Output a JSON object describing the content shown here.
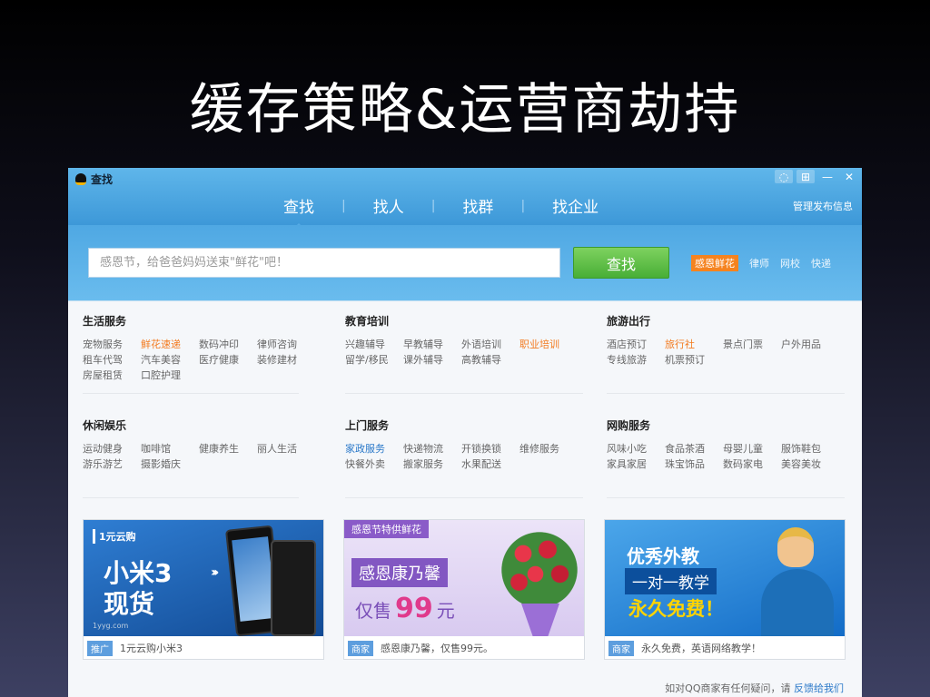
{
  "slide_title": "缓存策略&运营商劫持",
  "window": {
    "title": "查找",
    "controls": [
      "◌",
      "⊞",
      "—",
      "✕"
    ]
  },
  "tabs": [
    "查找",
    "找人",
    "找群",
    "找企业"
  ],
  "manage": "管理发布信息",
  "search": {
    "placeholder": "感恩节，给爸爸妈妈送束\"鲜花\"吧！",
    "button": "查找",
    "hot": [
      "感恩鲜花",
      "律师",
      "网校",
      "快递"
    ]
  },
  "categories": [
    {
      "title": "生活服务",
      "links": [
        "宠物服务",
        "鲜花速递",
        "数码冲印",
        "律师咨询",
        "租车代驾",
        "汽车美容",
        "医疗健康",
        "装修建材",
        "房屋租赁",
        "口腔护理"
      ]
    },
    {
      "title": "教育培训",
      "links": [
        "兴趣辅导",
        "早教辅导",
        "外语培训",
        "职业培训",
        "留学/移民",
        "课外辅导",
        "高教辅导"
      ]
    },
    {
      "title": "旅游出行",
      "links": [
        "酒店预订",
        "旅行社",
        "景点门票",
        "户外用品",
        "专线旅游",
        "机票预订"
      ]
    },
    {
      "title": "休闲娱乐",
      "links": [
        "运动健身",
        "咖啡馆",
        "健康养生",
        "丽人生活",
        "游乐游艺",
        "摄影婚庆"
      ]
    },
    {
      "title": "上门服务",
      "links": [
        "家政服务",
        "快递物流",
        "开锁换锁",
        "维修服务",
        "快餐外卖",
        "搬家服务",
        "水果配送"
      ]
    },
    {
      "title": "网购服务",
      "links": [
        "风味小吃",
        "食品茶酒",
        "母婴儿童",
        "服饰鞋包",
        "家具家居",
        "珠宝饰品",
        "数码家电",
        "美容美妆"
      ]
    }
  ],
  "ads": [
    {
      "logo": "1元云购",
      "line1": "小米3",
      "line2": "现货",
      "url": "1yyg.com",
      "tag": "推广",
      "caption": "1元云购小米3"
    },
    {
      "header": "感恩节特供鲜花",
      "line1": "感恩康乃馨",
      "line2": "仅售",
      "price": "99",
      "unit": "元",
      "tag": "商家",
      "caption": "感恩康乃馨，仅售99元。"
    },
    {
      "line1": "优秀外教",
      "line2": "一对一教学",
      "line3": "永久免费！",
      "tag": "商家",
      "caption": "永久免费，英语网络教学！"
    }
  ],
  "footer": {
    "text": "如对QQ商家有任何疑问，请",
    "link": "反馈给我们"
  },
  "colors": {
    "accent": "#3d98d8",
    "button": "#48ae36",
    "highlight": "#f37b20",
    "link": "#2b79c9"
  }
}
